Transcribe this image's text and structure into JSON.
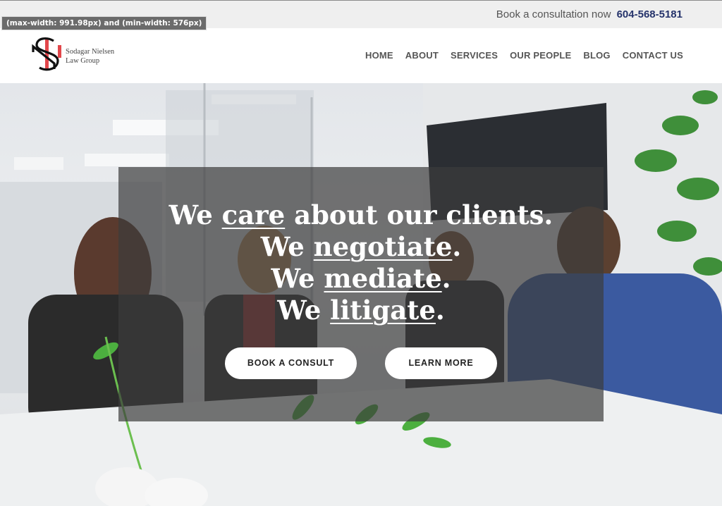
{
  "devtools": {
    "media_query": "(max-width: 991.98px) and (min-width: 576px)"
  },
  "topbar": {
    "consult_text": "Book a consultation now",
    "phone": "604-568-5181"
  },
  "brand": {
    "line1": "Sodagar Nielsen",
    "line2": "Law Group",
    "logo_icon": "sn-monogram-icon",
    "accent_color": "#e2474b"
  },
  "nav": {
    "items": [
      "HOME",
      "ABOUT",
      "SERVICES",
      "OUR PEOPLE",
      "BLOG",
      "CONTACT US"
    ]
  },
  "hero": {
    "line1_pre": "We ",
    "line1_word": "care",
    "line1_post": " about our clients.",
    "line2_pre": "We ",
    "line2_word": "negotiate",
    "line2_post": ".",
    "line3_pre": "We ",
    "line3_word": "mediate",
    "line3_post": ".",
    "line4_pre": "We ",
    "line4_word": "litigate",
    "line4_post": ".",
    "btn_consult": "BOOK A CONSULT",
    "btn_learn": "LEARN MORE"
  },
  "colors": {
    "phone": "#25336b",
    "overlay": "rgba(60,60,60,0.70)"
  }
}
